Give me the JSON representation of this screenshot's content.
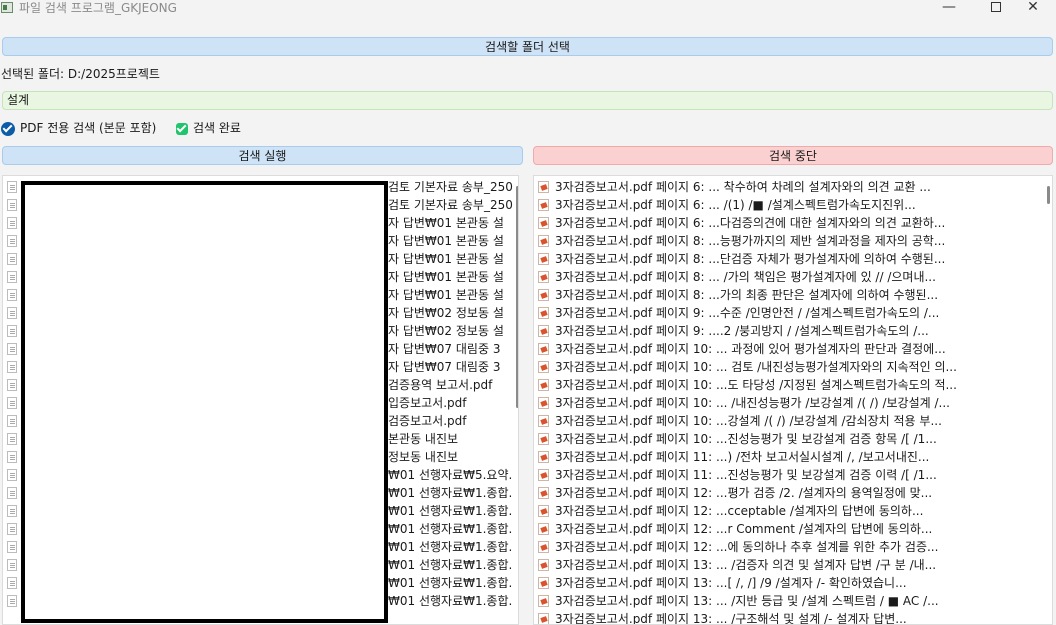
{
  "window": {
    "title": "파일 검색 프로그램_GKJEONG",
    "minimize": "—",
    "close": "✕"
  },
  "folder_button": "검색할 폴더 선택",
  "selected_folder_label": "선택된 폴더: D:/2025프로젝트",
  "keyword_value": "설계",
  "options": [
    {
      "label": "PDF 전용 검색 (본문 포함)",
      "checked": true,
      "icon": "checkbox-checked-icon"
    },
    {
      "label": "검색 완료",
      "checked": true,
      "icon": "checkbox-checked-icon"
    }
  ],
  "run_button": "검색 실행",
  "stop_button": "검색 중단",
  "file_list": [
    "검토 기본자료 송부_250",
    "검토 기본자료 송부_250",
    "자 답변₩01 본관동 설",
    "자 답변₩01 본관동 설",
    "자 답변₩01 본관동 설",
    "자 답변₩01 본관동 설",
    "자 답변₩01 본관동 설",
    "자 답변₩02 정보동 설",
    "자 답변₩02 정보동 설",
    "자 답변₩07 대림중 3",
    "자 답변₩07 대림중 3",
    "검증용역 보고서.pdf",
    "입증보고서.pdf",
    "검증보고서.pdf",
    "본관동 내진보",
    "정보동 내진보",
    "₩01 선행자료₩5.요약.",
    "₩01 선행자료₩1.종합.",
    "₩01 선행자료₩1.종합.",
    "₩01 선행자료₩1.종합.",
    "₩01 선행자료₩1.종합.",
    "₩01 선행자료₩1.종합.",
    "₩01 선행자료₩1.종합.",
    "₩01 선행자료₩1.종합."
  ],
  "result_list": [
    "3자검증보고서.pdf 페이지 6: ... 착수하여 차례의 설계자와의 의견 교환 ...",
    "3자검증보고서.pdf 페이지 6: ...  /(1) /■   /설계스펙트럼가속도지진위...",
    "3자검증보고서.pdf 페이지 6: ...다검증의견에 대한 설계자와의 의견 교환하...",
    "3자검증보고서.pdf 페이지 8: ...능평가까지의 제반 설계과정을 제자의 공학...",
    "3자검증보고서.pdf 페이지 8: ...단검증 자체가 평가설계자에 의하여 수행된...",
    "3자검증보고서.pdf 페이지 8: ... /가의 책임은 평가설계자에 있 // /으며내...",
    "3자검증보고서.pdf 페이지 8: ...가의 최종 판단은 설계자에 의하여 수행된...",
    "3자검증보고서.pdf 페이지 9: ...수준 /인명안전 /  /설계스펙트럼가속도의  /...",
    "3자검증보고서.pdf 페이지 9: ....2 /붕괴방지 /  /설계스펙트럼가속도의  /...",
    "3자검증보고서.pdf 페이지 10: ... 과정에 있어 평가설계자의 판단과 결정에...",
    "3자검증보고서.pdf 페이지 10: ... 검토 /내진성능평가설계자와의 지속적인 의...",
    "3자검증보고서.pdf 페이지 10: ...도 타당성 /지정된 설계스펙트럼가속도의 적...",
    "3자검증보고서.pdf 페이지 10: ... /내진성능평가 /보강설계 /( /) /보강설계 /...",
    "3자검증보고서.pdf 페이지 10: ...강설계 /( /) /보강설계 /감쇠장치 적용 부...",
    "3자검증보고서.pdf 페이지 10: ...진성능평가 및 보강설계 검증 항목 /[ /1...",
    "3자검증보고서.pdf 페이지 11: ...) /전차 보고서실시설계  /,  /보고서내진...",
    "3자검증보고서.pdf 페이지 11: ...진성능평가 및 보강설계 검증 이력 /[ /1...",
    "3자검증보고서.pdf 페이지 12: ...평가 검증 /2.  /설계자의 용역일정에 맞...",
    "3자검증보고서.pdf 페이지 12: ...cceptable /설계자의 답변에 동의하...",
    "3자검증보고서.pdf 페이지 12: ...r Comment /설계자의 답변에 동의하...",
    "3자검증보고서.pdf 페이지 12: ...에 동의하나 추후 설계를 위한 추가 검증...",
    "3자검증보고서.pdf 페이지 13: ... /검증자 의견 및 설계자 답변 /구 분 /내...",
    "3자검증보고서.pdf 페이지 13: ...[ /,  /]  /9 /설계자 /- 확인하였습니...",
    "3자검증보고서.pdf 페이지 13: ... /지반 등급 및  /설계 스펙트럼 / ■ AC /...",
    "3자검증보고서.pdf 페이지 13: ... /구조해석 및 설계 /- 설계자 답변..."
  ]
}
